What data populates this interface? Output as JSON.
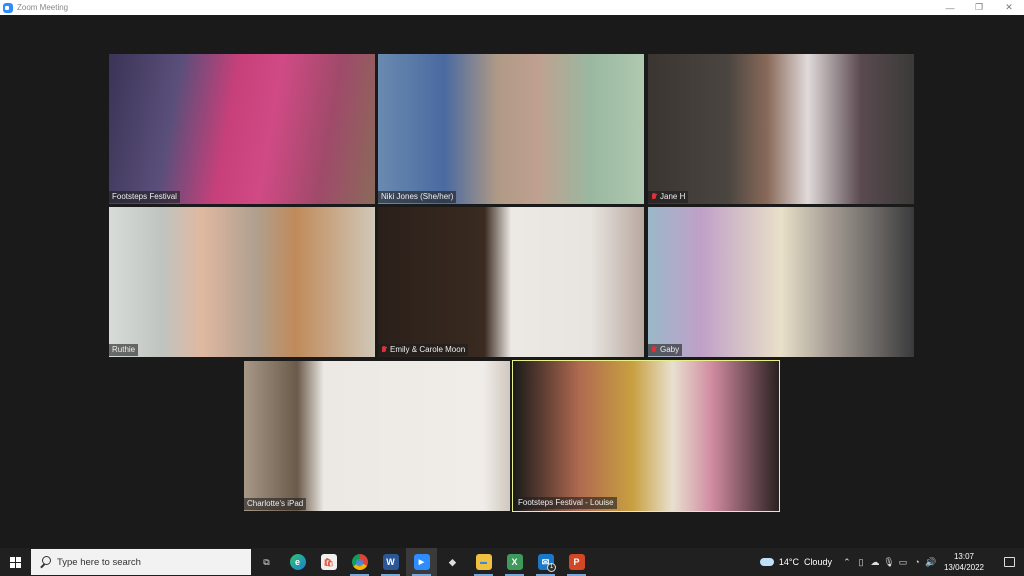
{
  "window": {
    "title": "Zoom Meeting",
    "controls": {
      "minimize": "—",
      "restore": "❐",
      "close": "✕"
    }
  },
  "gallery": {
    "participants": [
      {
        "name": "Footsteps Festival",
        "muted": false,
        "active_speaker": false
      },
      {
        "name": "Niki Jones (She/her)",
        "muted": false,
        "active_speaker": false
      },
      {
        "name": "Jane H",
        "muted": true,
        "active_speaker": false
      },
      {
        "name": "Ruthie",
        "muted": false,
        "active_speaker": false
      },
      {
        "name": "Emily & Carole Moon",
        "muted": true,
        "active_speaker": false
      },
      {
        "name": "Gaby",
        "muted": true,
        "active_speaker": false
      },
      {
        "name": "Charlotte's iPad",
        "muted": false,
        "active_speaker": false
      },
      {
        "name": "Footsteps Festival - Louise",
        "muted": false,
        "active_speaker": true
      }
    ],
    "active_speaker_color": "#e8f08a"
  },
  "taskbar": {
    "search_placeholder": "Type here to search",
    "apps": [
      {
        "name": "task-view",
        "glyph": "⧉",
        "running": false
      },
      {
        "name": "edge",
        "glyph": "e",
        "running": false
      },
      {
        "name": "microsoft-store",
        "glyph": "🛍",
        "running": false
      },
      {
        "name": "chrome",
        "glyph": "◉",
        "running": true
      },
      {
        "name": "word",
        "glyph": "W",
        "running": true
      },
      {
        "name": "zoom",
        "glyph": "▶",
        "running": true,
        "focused": true
      },
      {
        "name": "inkscape",
        "glyph": "◆",
        "running": false
      },
      {
        "name": "file-explorer",
        "glyph": "▬",
        "running": true
      },
      {
        "name": "excel",
        "glyph": "X",
        "running": true
      },
      {
        "name": "mail",
        "glyph": "✉",
        "running": true,
        "badge": "1"
      },
      {
        "name": "powerpoint",
        "glyph": "P",
        "running": true
      }
    ],
    "weather": {
      "temp": "14°C",
      "condition": "Cloudy"
    },
    "clock": {
      "time": "13:07",
      "date": "13/04/2022"
    }
  }
}
